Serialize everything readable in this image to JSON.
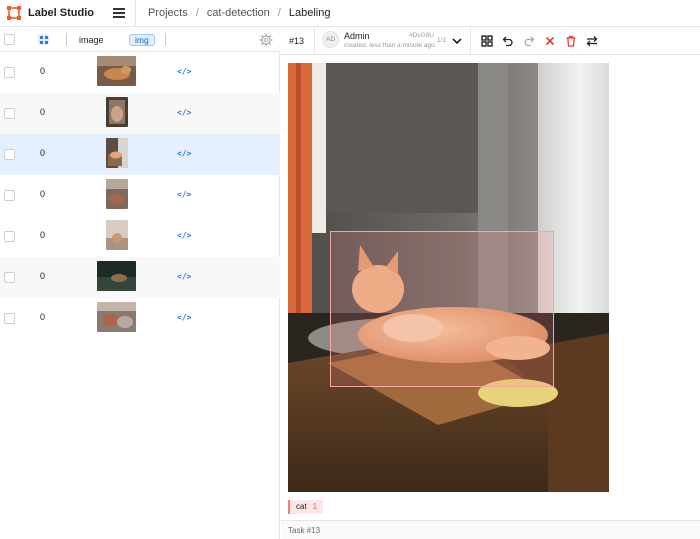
{
  "app": {
    "title": "Label Studio"
  },
  "breadcrumbs": {
    "items": [
      "Projects",
      "cat-detection",
      "Labeling"
    ]
  },
  "table": {
    "columns": {
      "image": "image",
      "img_tag": "img"
    },
    "rows": [
      {
        "count": "0",
        "code": "</>",
        "selected": false
      },
      {
        "count": "0",
        "code": "</>",
        "selected": false
      },
      {
        "count": "0",
        "code": "</>",
        "selected": true
      },
      {
        "count": "0",
        "code": "</>",
        "selected": false
      },
      {
        "count": "0",
        "code": "</>",
        "selected": false
      },
      {
        "count": "0",
        "code": "</>",
        "selected": false
      },
      {
        "count": "0",
        "code": "</>",
        "selected": false
      }
    ]
  },
  "editor": {
    "task_id": "#13",
    "annotation": {
      "avatar": "AD",
      "user": "Admin",
      "subtitle": "created, less than a minute ago",
      "hash": "#DsG8U",
      "count": "1/1"
    },
    "toolbar_icons": [
      "grid-icon",
      "undo-icon",
      "redo-icon",
      "close-icon",
      "trash-icon",
      "swap-icon"
    ],
    "region_label": {
      "name": "cat",
      "count": "1"
    },
    "footer": "Task #13"
  },
  "colors": {
    "accent": "#2f74e8",
    "selected_row": "#e4f0fe",
    "bbox": "#f4a5a5",
    "danger": "#e53935"
  }
}
